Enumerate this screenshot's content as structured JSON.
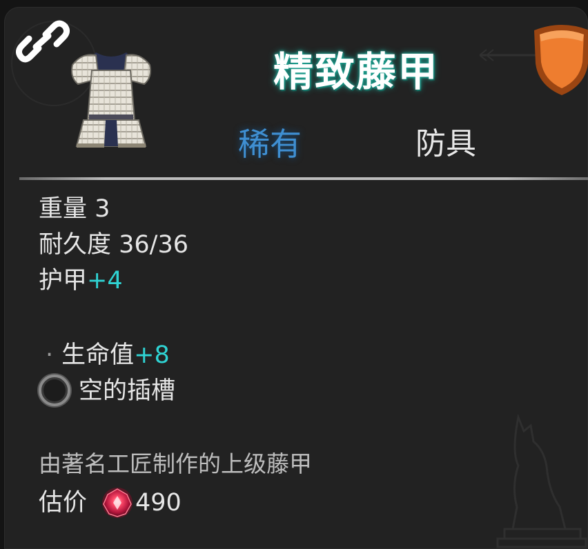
{
  "item": {
    "name": "精致藤甲",
    "rarity": "稀有",
    "category": "防具",
    "rarity_color": "#3f8fd2",
    "name_glow_color": "#1c9a8a"
  },
  "stats": {
    "weight": "重量 3",
    "durability": "耐久度 36/36",
    "armor_label": "护甲",
    "armor_value": "+4"
  },
  "bonus": {
    "bullet": "·",
    "hp_label": "生命值",
    "hp_value": "+8",
    "value_color": "#2fd3d3"
  },
  "socket": {
    "label": "空的插槽"
  },
  "description": "由著名工匠制作的上级藤甲",
  "price": {
    "label": "估价",
    "value": "490",
    "currency_icon": "red-gem-icon"
  },
  "icons": {
    "link": "chain-link-icon",
    "badge": "orange-shield-icon",
    "item_image": "lamellar-armor-icon"
  }
}
